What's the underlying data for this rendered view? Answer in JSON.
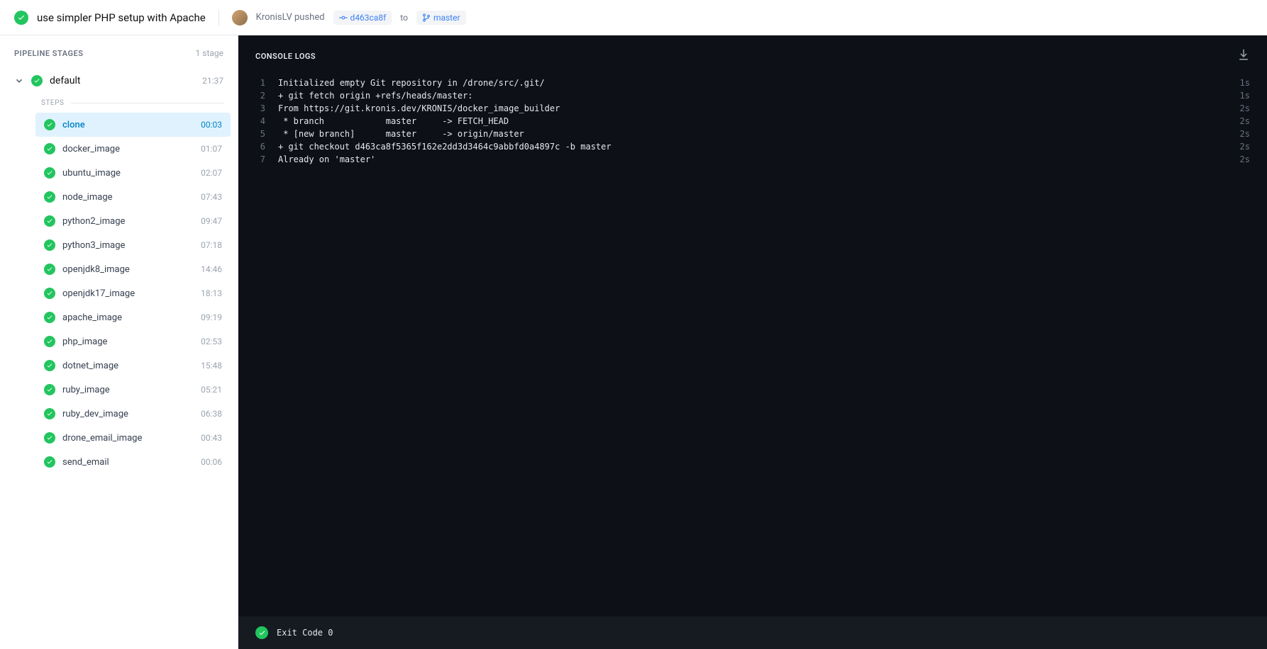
{
  "header": {
    "commit_title": "use simpler PHP setup with Apache",
    "user": "KronisLV",
    "action": "pushed",
    "commit_hash": "d463ca8f",
    "to": "to",
    "branch": "master"
  },
  "sidebar": {
    "title": "PIPELINE STAGES",
    "stage_count": "1 stage",
    "stage": {
      "name": "default",
      "time": "21:37"
    },
    "steps_label": "STEPS",
    "steps": [
      {
        "name": "clone",
        "time": "00:03",
        "active": true
      },
      {
        "name": "docker_image",
        "time": "01:07"
      },
      {
        "name": "ubuntu_image",
        "time": "02:07"
      },
      {
        "name": "node_image",
        "time": "07:43"
      },
      {
        "name": "python2_image",
        "time": "09:47"
      },
      {
        "name": "python3_image",
        "time": "07:18"
      },
      {
        "name": "openjdk8_image",
        "time": "14:46"
      },
      {
        "name": "openjdk17_image",
        "time": "18:13"
      },
      {
        "name": "apache_image",
        "time": "09:19"
      },
      {
        "name": "php_image",
        "time": "02:53"
      },
      {
        "name": "dotnet_image",
        "time": "15:48"
      },
      {
        "name": "ruby_image",
        "time": "05:21"
      },
      {
        "name": "ruby_dev_image",
        "time": "06:38"
      },
      {
        "name": "drone_email_image",
        "time": "00:43"
      },
      {
        "name": "send_email",
        "time": "00:06"
      }
    ]
  },
  "console": {
    "title": "CONSOLE LOGS",
    "lines": [
      {
        "n": "1",
        "text": "Initialized empty Git repository in /drone/src/.git/",
        "dur": "1s"
      },
      {
        "n": "2",
        "text": "+ git fetch origin +refs/heads/master:",
        "dur": "1s"
      },
      {
        "n": "3",
        "text": "From https://git.kronis.dev/KRONIS/docker_image_builder",
        "dur": "2s"
      },
      {
        "n": "4",
        "text": " * branch            master     -> FETCH_HEAD",
        "dur": "2s"
      },
      {
        "n": "5",
        "text": " * [new branch]      master     -> origin/master",
        "dur": "2s"
      },
      {
        "n": "6",
        "text": "+ git checkout d463ca8f5365f162e2dd3d3464c9abbfd0a4897c -b master",
        "dur": "2s"
      },
      {
        "n": "7",
        "text": "Already on 'master'",
        "dur": "2s"
      }
    ],
    "footer": "Exit Code 0"
  }
}
